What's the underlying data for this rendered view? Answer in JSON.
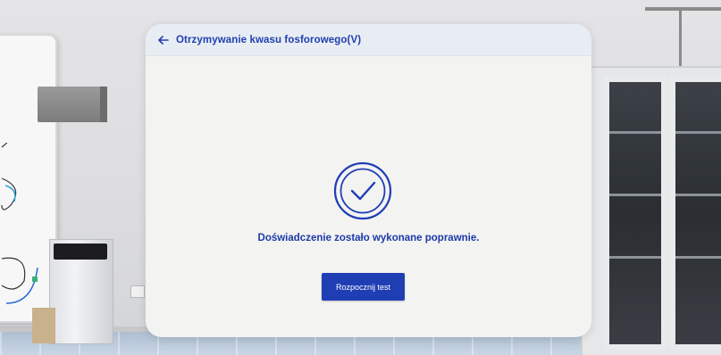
{
  "panel": {
    "title": "Otrzymywanie kwasu fosforowego(V)",
    "back_icon": "arrow-left-icon",
    "success_icon": "check-circle-icon",
    "message": "Doświadczenie zostało wykonane poprawnie.",
    "start_button_label": "Rozpocznij test"
  },
  "colors": {
    "accent": "#1f3eb4",
    "header_bg": "#e8edf3",
    "panel_bg": "#f3f3f2",
    "text": "#1d3aa8"
  }
}
